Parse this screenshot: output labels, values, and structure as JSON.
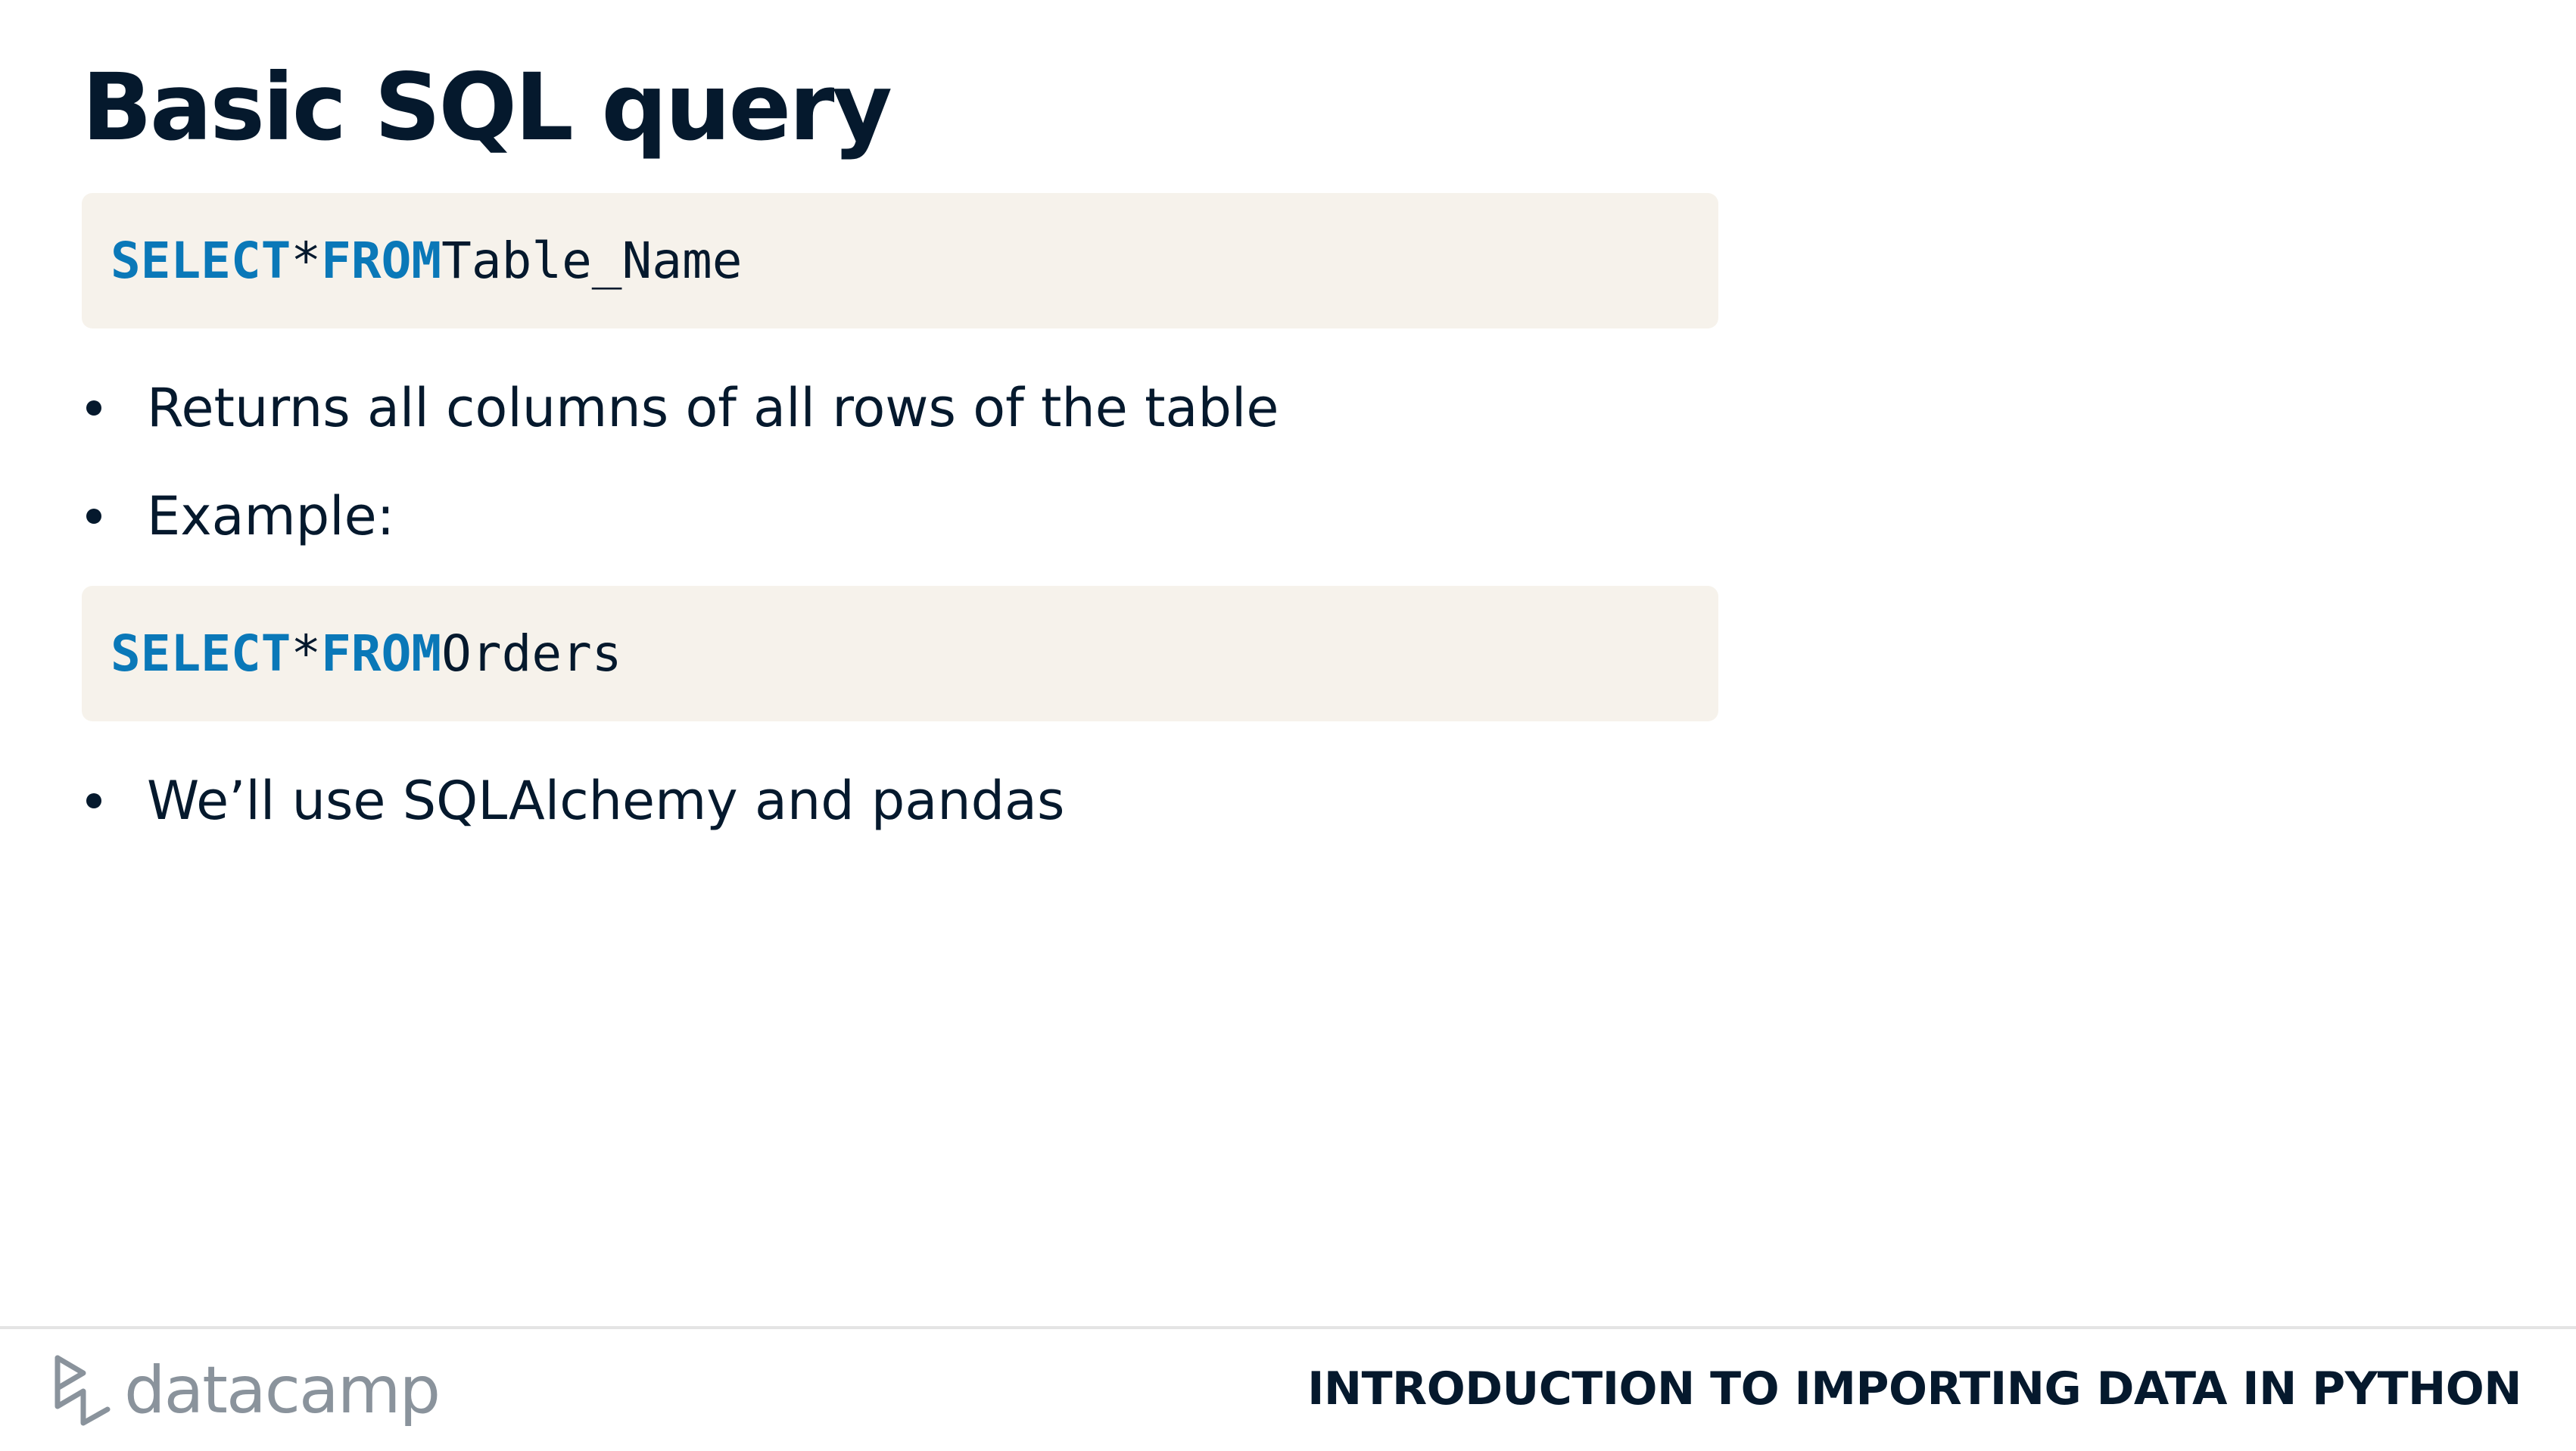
{
  "slide": {
    "title": "Basic SQL query"
  },
  "code_blocks": [
    {
      "keyword1": "SELECT",
      "operator": "*",
      "keyword2": "FROM",
      "identifier": "Table_Name"
    },
    {
      "keyword1": "SELECT",
      "operator": "*",
      "keyword2": "FROM",
      "identifier": "Orders"
    }
  ],
  "bullets": [
    "Returns all columns of all rows of the table",
    "Example:",
    "We’ll use SQLAlchemy and pandas"
  ],
  "footer": {
    "logo_text": "datacamp",
    "course_title": "INTRODUCTION TO IMPORTING DATA IN PYTHON"
  },
  "colors": {
    "text": "#05192d",
    "code_keyword": "#0a78b8",
    "code_background": "#f6f2eb",
    "logo": "#8a939c",
    "rule": "#e4e4e4"
  }
}
